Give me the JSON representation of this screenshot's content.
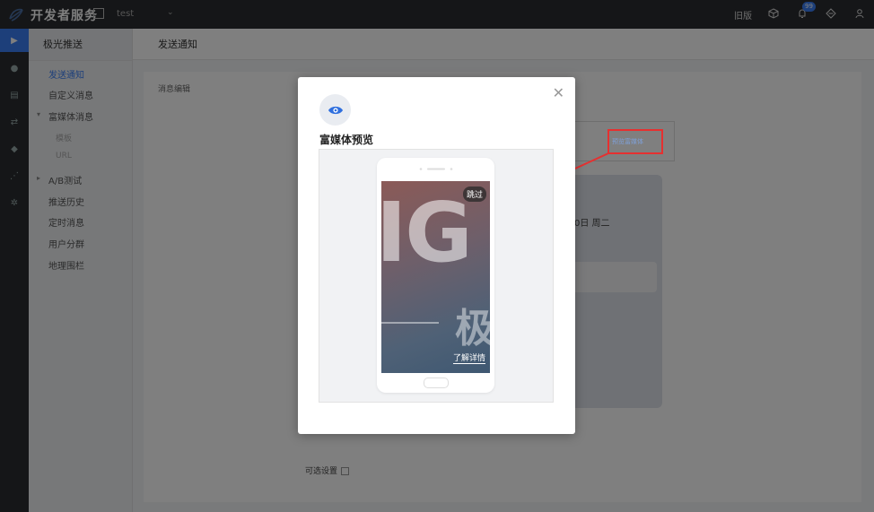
{
  "topbar": {
    "title": "开发者服务",
    "app_name": "test",
    "old_version": "旧版",
    "notification_count": "99"
  },
  "rail": {
    "icons": [
      "play-icon",
      "cloud-icon",
      "message-icon",
      "share-icon",
      "shield-icon",
      "network-icon",
      "settings-icon"
    ]
  },
  "sidebar": {
    "heading": "极光推送",
    "items": [
      {
        "label": "发送通知"
      },
      {
        "label": "自定义消息"
      },
      {
        "label": "富媒体消息"
      },
      {
        "label": "模板"
      },
      {
        "label": "URL"
      },
      {
        "label": "A/B测试"
      },
      {
        "label": "推送历史"
      },
      {
        "label": "定时消息"
      },
      {
        "label": "用户分群"
      },
      {
        "label": "地理围栏"
      }
    ]
  },
  "main": {
    "heading": "发送通知",
    "editor_label": "消息编辑",
    "optional_settings": "可选设置",
    "bg_date": "0日 周二"
  },
  "annotation": {
    "box_text": "预览富媒体"
  },
  "modal": {
    "title": "富媒体预览",
    "skip": "跳过",
    "learn_more": "了解详情",
    "big_text": "IG",
    "big_char": "极"
  }
}
